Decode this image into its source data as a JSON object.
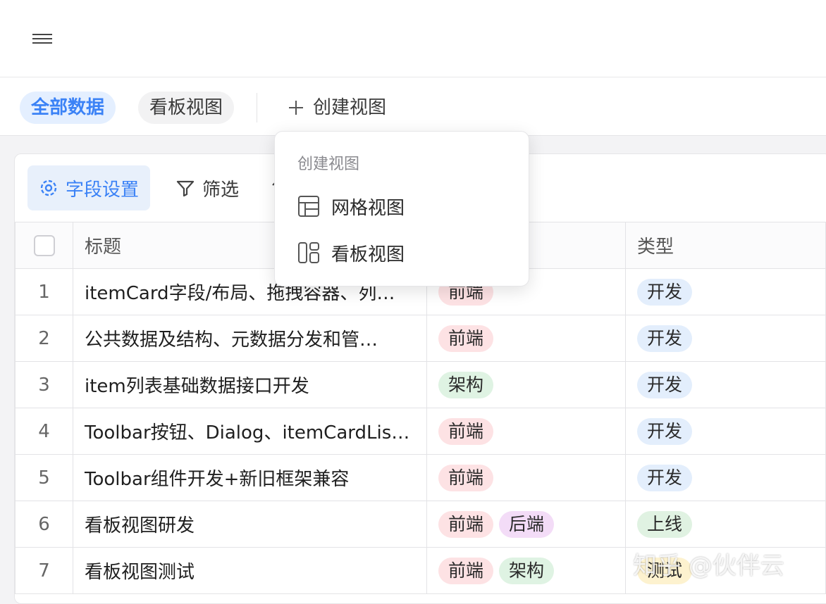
{
  "header": {
    "menu_icon": "hamburger-menu-icon"
  },
  "views": {
    "tabs": [
      {
        "label": "全部数据",
        "active": true
      },
      {
        "label": "看板视图",
        "active": false
      }
    ],
    "create_label": "创建视图"
  },
  "toolbar": {
    "field_settings": "字段设置",
    "filter": "筛选"
  },
  "dropdown": {
    "title": "创建视图",
    "items": [
      {
        "label": "网格视图",
        "icon": "grid-table-icon"
      },
      {
        "label": "看板视图",
        "icon": "kanban-board-icon"
      }
    ]
  },
  "table": {
    "columns": [
      "",
      "标题",
      "",
      "类型"
    ],
    "rows": [
      {
        "num": "1",
        "title": "itemCard字段/布局、拖拽容器、列…",
        "tags": [
          "前端"
        ],
        "type": "开发"
      },
      {
        "num": "2",
        "title": "公共数据及结构、元数据分发和管…",
        "tags": [
          "前端"
        ],
        "type": "开发"
      },
      {
        "num": "3",
        "title": "item列表基础数据接口开发",
        "tags": [
          "架构"
        ],
        "type": "开发"
      },
      {
        "num": "4",
        "title": "Toolbar按钮、Dialog、itemCardLis…",
        "tags": [
          "前端"
        ],
        "type": "开发"
      },
      {
        "num": "5",
        "title": "Toolbar组件开发+新旧框架兼容",
        "tags": [
          "前端"
        ],
        "type": "开发"
      },
      {
        "num": "6",
        "title": "看板视图研发",
        "tags": [
          "前端",
          "后端"
        ],
        "type": "上线"
      },
      {
        "num": "7",
        "title": "看板视图测试",
        "tags": [
          "前端",
          "架构"
        ],
        "type": "测试"
      }
    ]
  },
  "tag_colors": {
    "前端": {
      "bg": "#fde2e4",
      "fg": "#2a2a2a"
    },
    "后端": {
      "bg": "#f3dcf7",
      "fg": "#2a2a2a"
    },
    "架构": {
      "bg": "#dff3e3",
      "fg": "#2a2a2a"
    },
    "开发": {
      "bg": "#e3eefc",
      "fg": "#2a2a2a"
    },
    "上线": {
      "bg": "#e0f2e2",
      "fg": "#2a2a2a"
    },
    "测试": {
      "bg": "#fdf2cf",
      "fg": "#2a2a2a"
    }
  },
  "watermark": "知乎 @伙伴云",
  "colors": {
    "accent": "#3b82f6",
    "active_bg": "#e4efff"
  }
}
